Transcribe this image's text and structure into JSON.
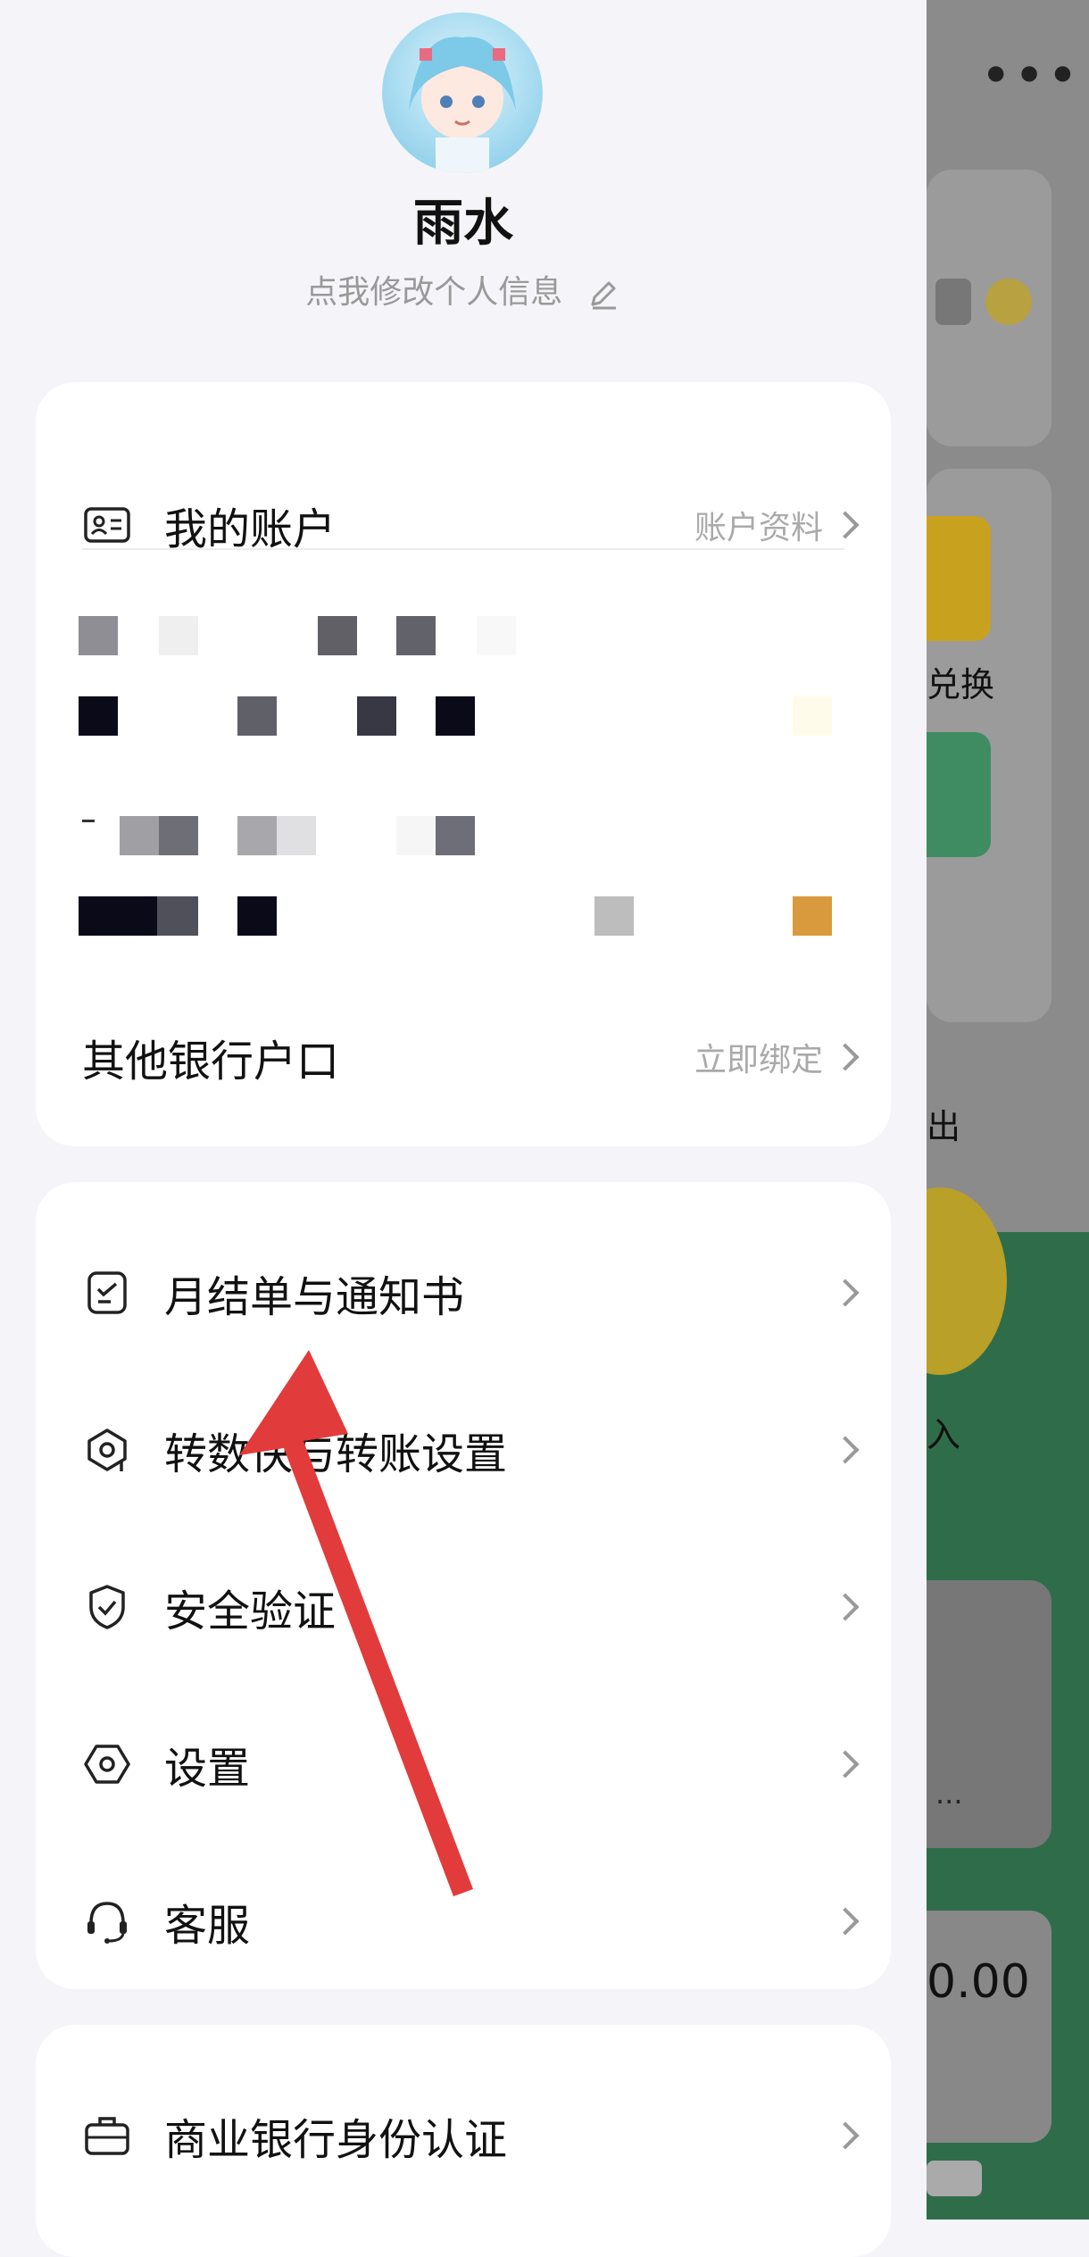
{
  "profile": {
    "nickname": "雨水",
    "edit_hint": "点我修改个人信息"
  },
  "accounts_card": {
    "my_account": {
      "label": "我的账户",
      "right": "账户资料"
    },
    "other_bank": {
      "label": "其他银行户口",
      "right": "立即绑定"
    }
  },
  "menu_card": {
    "items": [
      {
        "label": "月结单与通知书"
      },
      {
        "label": "转数快与转账设置"
      },
      {
        "label": "安全验证"
      },
      {
        "label": "设置"
      },
      {
        "label": "客服"
      }
    ]
  },
  "business_card": {
    "label": "商业银行身份认证"
  },
  "background": {
    "exchange_label": "兑换",
    "out_label": "出",
    "in_label": "入",
    "amount": "0.00",
    "more": "•••",
    "dots": "..."
  },
  "colors": {
    "arrow": "#e23b3b",
    "page_bg": "#f5f5f9",
    "card_bg": "#ffffff",
    "overlay": "#8b8b8b"
  },
  "icons": [
    "id-card-icon",
    "statement-icon",
    "fps-transfer-icon",
    "shield-check-icon",
    "hexagon-settings-icon",
    "headset-icon",
    "briefcase-icon",
    "pencil-icon",
    "more-icon",
    "chevron-right-icon"
  ]
}
